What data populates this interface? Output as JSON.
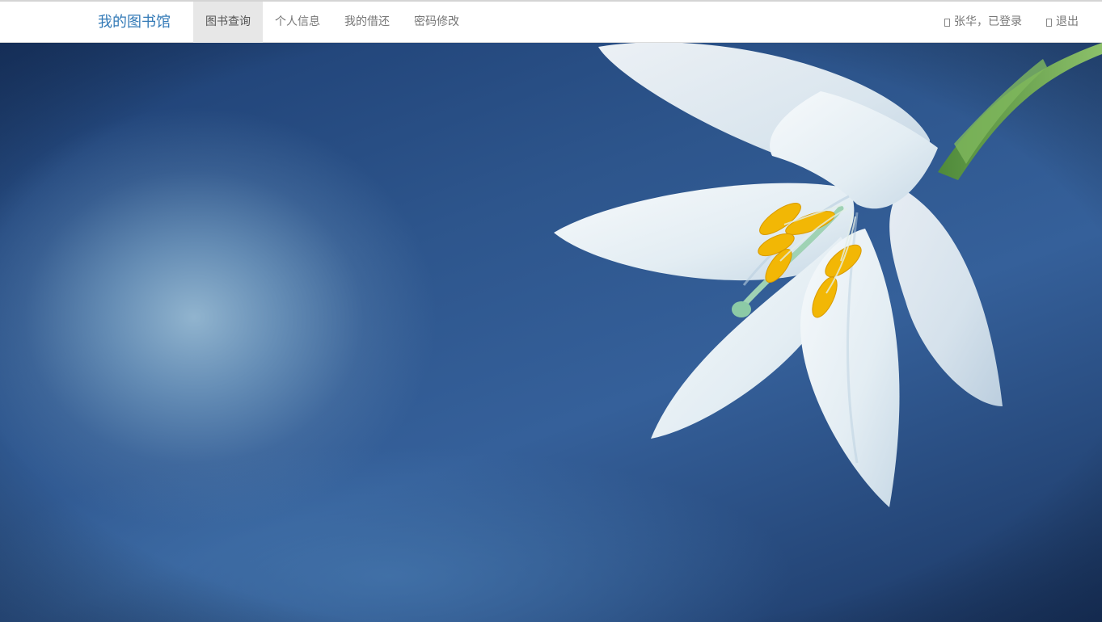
{
  "navbar": {
    "brand": "我的图书馆",
    "items": [
      {
        "label": "图书查询",
        "active": true
      },
      {
        "label": "个人信息",
        "active": false
      },
      {
        "label": "我的借还",
        "active": false
      },
      {
        "label": "密码修改",
        "active": false
      }
    ],
    "user_status": "张华，已登录",
    "logout": "退出",
    "user_icon": "user-icon",
    "logout_icon": "logout-icon"
  },
  "hero": {
    "image_subject": "white-lily-flower",
    "colors": {
      "brand": "#337ab7",
      "background_dark": "#1d3e72",
      "background_light": "#96b9d2",
      "petal": "#eef3f6",
      "stamen": "#f2b705",
      "stem": "#6aa84f"
    }
  }
}
